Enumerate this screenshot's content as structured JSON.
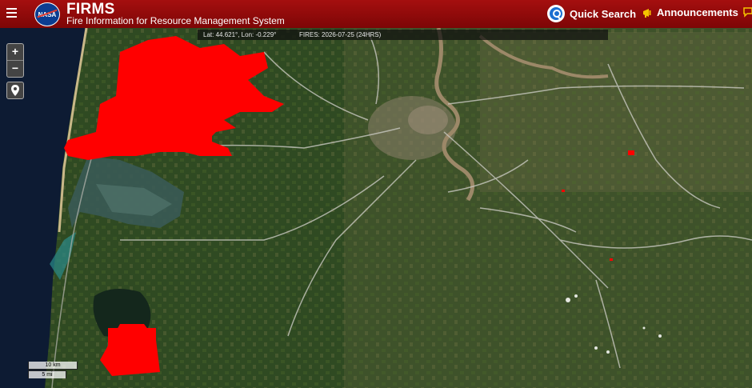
{
  "header": {
    "logo_text": "NASA",
    "title": "FIRMS",
    "subtitle": "Fire Information for Resource Management System",
    "quick_search": "Quick Search",
    "announcements": "Announcements"
  },
  "infobar": {
    "coords": "Lat: 44.621°, Lon: -0.229°",
    "fires": "FIRES: 2026-07-25 (24HRS)"
  },
  "controls": {
    "zoom_in": "+",
    "zoom_out": "−"
  },
  "scale": {
    "km": "10 km",
    "mi": "5 mi"
  },
  "colors": {
    "header": "#a50f0f",
    "fire": "#ff0000",
    "quick_search_icon": "#1a6fd1",
    "announcement_icon": "#f5c400"
  }
}
